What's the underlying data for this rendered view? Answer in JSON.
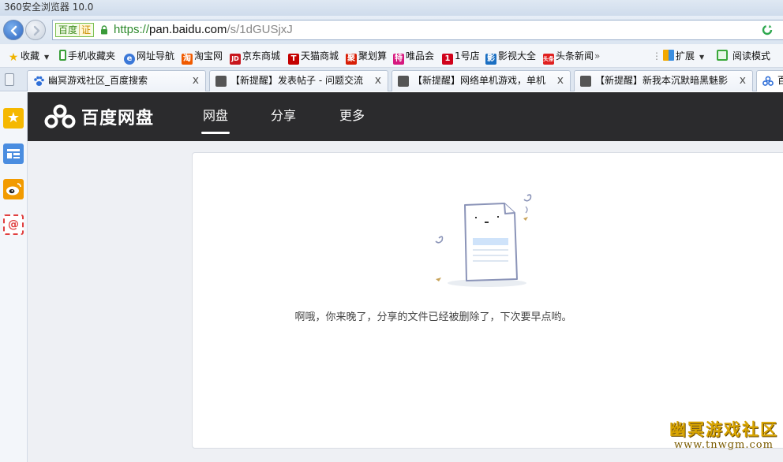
{
  "window": {
    "title": "360安全浏览器 10.0"
  },
  "address_bar": {
    "identity_badge": "百度",
    "cert_badge": "证",
    "url_scheme": "https://",
    "url_host": "pan.baidu.com",
    "url_path": "/s/1dGUSjxJ"
  },
  "bookmarks": {
    "items": [
      {
        "label": "收藏",
        "icon": "star-icon",
        "color": "#f0b400"
      },
      {
        "label": "手机收藏夹",
        "icon": "phone-icon",
        "color": "#3a9f3a"
      },
      {
        "label": "网址导航",
        "icon": "globe-icon",
        "color": "#3b78d8"
      },
      {
        "label": "淘宝网",
        "icon": "taobao-icon",
        "color": "#f05a00"
      },
      {
        "label": "京东商城",
        "icon": "jd-icon",
        "color": "#c8161d"
      },
      {
        "label": "天猫商城",
        "icon": "tmall-icon",
        "color": "#c40000"
      },
      {
        "label": "聚划算",
        "icon": "juhuasuan-icon",
        "color": "#d81e06"
      },
      {
        "label": "唯品会",
        "icon": "vip-icon",
        "color": "#d6197f"
      },
      {
        "label": "1号店",
        "icon": "yhd-icon",
        "color": "#d0021b"
      },
      {
        "label": "影视大全",
        "icon": "video-icon",
        "color": "#1b6fc2"
      },
      {
        "label": "头条新闻",
        "icon": "toutiao-icon",
        "color": "#e02020"
      }
    ],
    "more_glyph": "»",
    "extensions_label": "扩展",
    "reading_mode_label": "阅读模式"
  },
  "tabs": [
    {
      "label": "幽冥游戏社区_百度搜索",
      "close": "x",
      "favicon": "baidu-paw-icon",
      "color": "#2f6fd8"
    },
    {
      "label": "【新提醒】发表帖子 - 问题交流",
      "close": "x",
      "favicon": "forum-avatar-icon",
      "color": "#555555"
    },
    {
      "label": "【新提醒】网络单机游戏，单机",
      "close": "x",
      "favicon": "forum-avatar-icon",
      "color": "#555555"
    },
    {
      "label": "【新提醒】新我本沉默暗黑魅影",
      "close": "x",
      "favicon": "forum-avatar-icon",
      "color": "#555555"
    },
    {
      "label": "百",
      "close": "",
      "favicon": "baidu-cloud-icon",
      "color": "#2f6fd8"
    }
  ],
  "sidebar": {
    "items": [
      {
        "name": "favorites-star-icon",
        "color": "#f5b800"
      },
      {
        "name": "news-panel-icon",
        "color": "#4a8de0"
      },
      {
        "name": "weibo-icon",
        "color": "#f29b00"
      },
      {
        "name": "email-icon",
        "color": "#e04040"
      }
    ]
  },
  "pan": {
    "logo_text": "百度网盘",
    "nav": [
      {
        "label": "网盘",
        "active": true
      },
      {
        "label": "分享",
        "active": false
      },
      {
        "label": "更多",
        "active": false
      }
    ],
    "empty_message": "啊哦，你来晚了，分享的文件已经被删除了，下次要早点哟。"
  },
  "watermark": {
    "title": "幽冥游戏社区",
    "site": "www.tnwgm.com"
  }
}
